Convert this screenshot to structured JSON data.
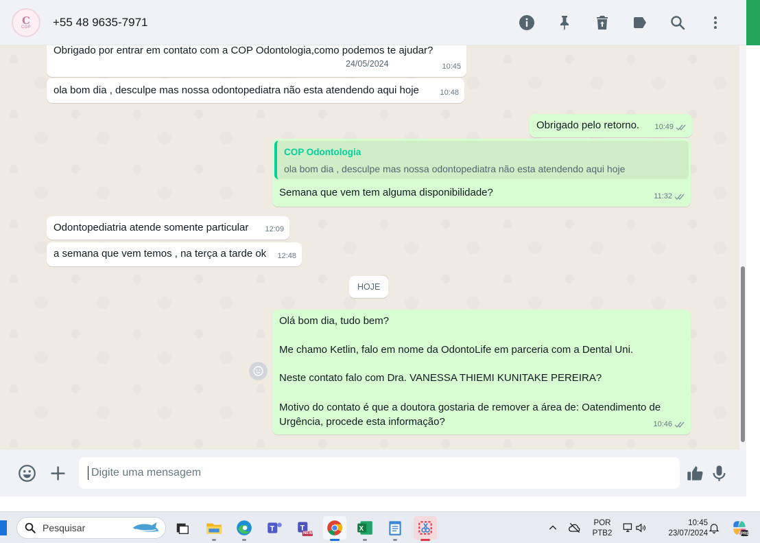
{
  "header": {
    "contact_name": "+55 48 9635-7971",
    "avatar_logo_letter": "C",
    "avatar_logo_text": "COP",
    "icons": [
      "info-icon",
      "pin-icon",
      "delete-icon",
      "label-icon",
      "search-icon",
      "menu-icon"
    ]
  },
  "chat": {
    "floating_date": "24/05/2024",
    "messages": [
      {
        "dir": "in",
        "text": "Obrigado por entrar em contato com a COP Odontologia,como podemos te ajudar?",
        "time": "10:45"
      },
      {
        "dir": "in",
        "text": "ola bom dia , desculpe mas nossa odontopediatra não esta atendendo aqui hoje",
        "time": "10:48"
      },
      {
        "dir": "out",
        "text": "Obrigado pelo retorno.",
        "time": "10:49"
      },
      {
        "dir": "out",
        "quote_name": "COP Odontologia",
        "quote_text": "ola bom dia , desculpe mas nossa odontopediatra não esta atendendo aqui hoje",
        "text": "Semana que vem tem alguma disponibilidade?",
        "time": "11:32"
      },
      {
        "dir": "in",
        "text": "Odontopediatria atende somente particular",
        "time": "12:09"
      },
      {
        "dir": "in",
        "text": "a semana que vem temos , na terça a tarde ok",
        "time": "12:48"
      },
      {
        "dir": "out",
        "lines": [
          "Olá bom dia, tudo bem?",
          "Me chamo Ketlin, falo em nome da OdontoLife em parceria com a Dental Uni.",
          "Neste contato falo com Dra. VANESSA THIEMI KUNITAKE PEREIRA?",
          "Motivo do contato é que a doutora gostaria de remover a área de: Oatendimento de Urgência, procede esta informação?"
        ],
        "time": "10:46"
      }
    ],
    "today_label": "HOJE"
  },
  "composer": {
    "placeholder": "Digite uma mensagem"
  },
  "taskbar": {
    "search_label": "Pesquisar",
    "lang_top": "POR",
    "lang_bottom": "PTB2",
    "clock_time": "10:45",
    "clock_date": "23/07/2024",
    "teams_badge": "NEW",
    "copilot_badge": "PRE"
  },
  "colors": {
    "incoming": "#ffffff",
    "outgoing": "#d9fdd3",
    "accent": "#25a45c",
    "quote_accent": "#06cf9c"
  }
}
